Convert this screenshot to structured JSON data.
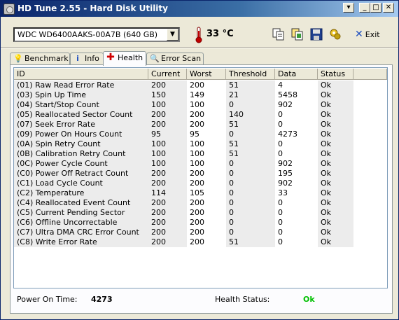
{
  "window": {
    "title": "HD Tune 2.55 - Hard Disk Utility"
  },
  "toolbar": {
    "drive": "WDC WD6400AAKS-00A7B (640 GB)",
    "temperature": "33 °C",
    "exit_label": "Exit",
    "icons": [
      "copy-info-icon",
      "copy-screenshot-icon",
      "save-icon",
      "options-icon",
      "exit-icon"
    ]
  },
  "tabs": [
    {
      "label": "Benchmark",
      "icon": "lightbulb-icon",
      "active": false
    },
    {
      "label": "Info",
      "icon": "info-icon",
      "active": false
    },
    {
      "label": "Health",
      "icon": "red-cross-icon",
      "active": true
    },
    {
      "label": "Error Scan",
      "icon": "magnifier-icon",
      "active": false
    }
  ],
  "table": {
    "columns": [
      "ID",
      "Current",
      "Worst",
      "Threshold",
      "Data",
      "Status"
    ],
    "rows": [
      [
        "(01) Raw Read Error Rate",
        "200",
        "200",
        "51",
        "4",
        "Ok"
      ],
      [
        "(03) Spin Up Time",
        "150",
        "149",
        "21",
        "5458",
        "Ok"
      ],
      [
        "(04) Start/Stop Count",
        "100",
        "100",
        "0",
        "902",
        "Ok"
      ],
      [
        "(05) Reallocated Sector Count",
        "200",
        "200",
        "140",
        "0",
        "Ok"
      ],
      [
        "(07) Seek Error Rate",
        "200",
        "200",
        "51",
        "0",
        "Ok"
      ],
      [
        "(09) Power On Hours Count",
        "95",
        "95",
        "0",
        "4273",
        "Ok"
      ],
      [
        "(0A) Spin Retry Count",
        "100",
        "100",
        "51",
        "0",
        "Ok"
      ],
      [
        "(0B) Calibration Retry Count",
        "100",
        "100",
        "51",
        "0",
        "Ok"
      ],
      [
        "(0C) Power Cycle Count",
        "100",
        "100",
        "0",
        "902",
        "Ok"
      ],
      [
        "(C0) Power Off Retract Count",
        "200",
        "200",
        "0",
        "195",
        "Ok"
      ],
      [
        "(C1) Load Cycle Count",
        "200",
        "200",
        "0",
        "902",
        "Ok"
      ],
      [
        "(C2) Temperature",
        "114",
        "105",
        "0",
        "33",
        "Ok"
      ],
      [
        "(C4) Reallocated Event Count",
        "200",
        "200",
        "0",
        "0",
        "Ok"
      ],
      [
        "(C5) Current Pending Sector",
        "200",
        "200",
        "0",
        "0",
        "Ok"
      ],
      [
        "(C6) Offline Uncorrectable",
        "200",
        "200",
        "0",
        "0",
        "Ok"
      ],
      [
        "(C7) Ultra DMA CRC Error Count",
        "200",
        "200",
        "0",
        "0",
        "Ok"
      ],
      [
        "(C8) Write Error Rate",
        "200",
        "200",
        "51",
        "0",
        "Ok"
      ]
    ]
  },
  "status": {
    "power_on_label": "Power On Time:",
    "power_on_value": "4273",
    "health_label": "Health Status:",
    "health_value": "Ok"
  },
  "colors": {
    "titlebar": "#0a246a",
    "health_ok": "#00c000",
    "thermometer": "#c00000"
  }
}
